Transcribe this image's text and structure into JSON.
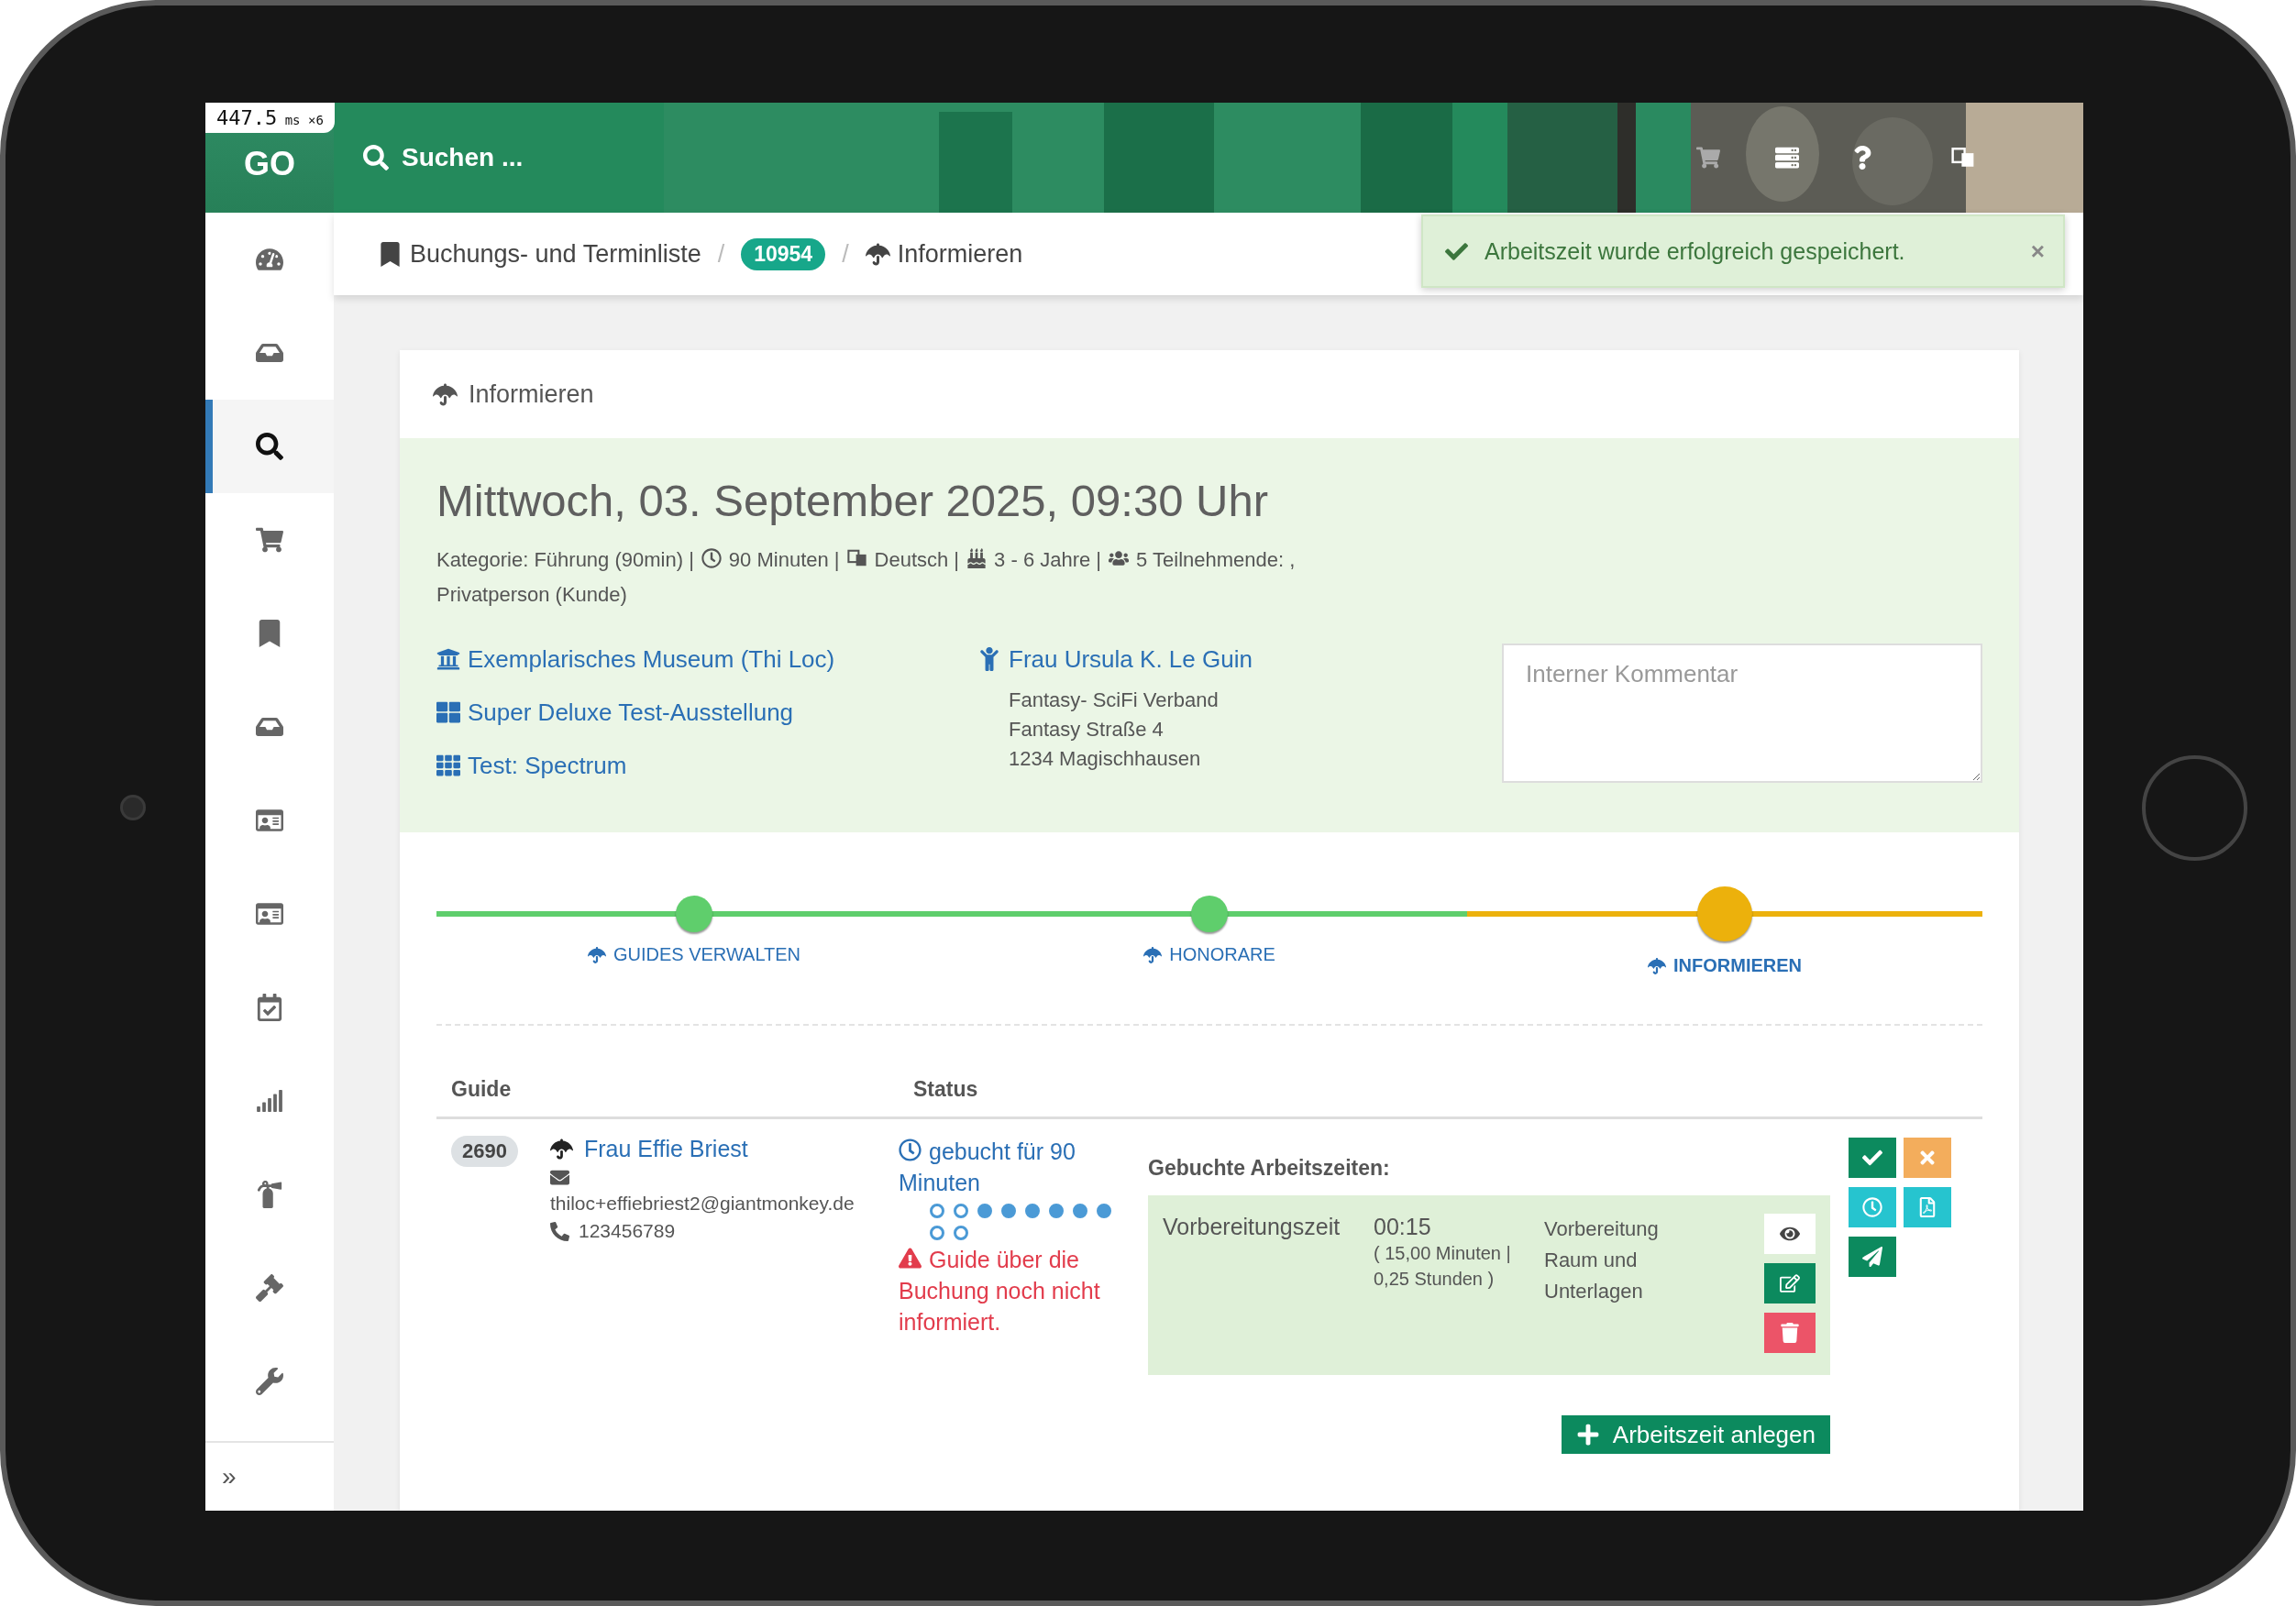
{
  "timing_overlay": {
    "value": "447.5",
    "unit": "ms",
    "count": "×6"
  },
  "topbar": {
    "logo": "GO",
    "search": "Suchen ..."
  },
  "sidebar": {
    "items": [
      {
        "selected": false
      },
      {
        "selected": false
      },
      {
        "selected": true
      },
      {
        "selected": false
      },
      {
        "selected": false
      },
      {
        "selected": false
      },
      {
        "selected": false
      },
      {
        "selected": false
      },
      {
        "selected": false
      },
      {
        "selected": false
      },
      {
        "selected": false
      },
      {
        "selected": false
      },
      {
        "selected": false
      }
    ],
    "expand": "»"
  },
  "breadcrumb": {
    "items": [
      {
        "kind": "link",
        "label": "Buchungs- und Terminliste"
      },
      {
        "kind": "badge",
        "label": "10954"
      },
      {
        "kind": "current",
        "label": "Informieren"
      }
    ],
    "separators": [
      "/",
      "/"
    ]
  },
  "toast": {
    "message": "Arbeitszeit wurde erfolgreich gespeichert.",
    "close": "×"
  },
  "card": {
    "title": "Informieren",
    "date": "Mittwoch, 03. September 2025, 09:30 Uhr",
    "meta": [
      "Kategorie: Führung (90min) |",
      "90 Minuten |",
      "Deutsch |",
      "3 - 6 Jahre |",
      "5 Teilnehmende: ,",
      "Privatperson (Kunde)"
    ],
    "links": [
      "Exemplarisches Museum (Thi Loc)",
      "Super Deluxe Test-Ausstellung",
      "Test: Spectrum"
    ],
    "contact": {
      "name": "Frau Ursula K. Le Guin",
      "lines": [
        "Fantasy- SciFi Verband",
        "Fantasy Straße 4",
        "1234 Magischhausen"
      ]
    },
    "comment": {
      "placeholder": "Interner Kommentar"
    },
    "steps": [
      {
        "label": "GUIDES VERWALTEN",
        "done": true,
        "selected": false
      },
      {
        "label": "HONORARE",
        "done": true,
        "selected": false
      },
      {
        "label": "INFORMIEREN",
        "selected": true
      }
    ],
    "table": {
      "columns": [
        "Guide",
        "Status"
      ],
      "rows": [
        {
          "id": "2690",
          "name": "Frau Effie Briest",
          "email": "thiloc+effiebriest2@giantmonkey.de",
          "phone": "123456789",
          "status": "gebucht für 90 Minuten",
          "dots": [
            {
              "filled": false
            },
            {
              "filled": false
            },
            {
              "filled": true
            },
            {
              "filled": true
            },
            {
              "filled": true
            },
            {
              "filled": true
            },
            {
              "filled": true
            },
            {
              "filled": true
            },
            {
              "filled": false
            },
            {
              "filled": false
            }
          ],
          "warning": "Guide über die Buchung noch nicht informiert.",
          "worktimes_title": "Gebuchte Arbeitszeiten:",
          "worktimes": [
            {
              "type": "Vorbereitungszeit",
              "duration": "00:15",
              "detail": "( 15,00 Minuten | 0,25 Stunden )",
              "note": "Vorbereitung Raum und Unterlagen"
            }
          ],
          "add_button": "Arbeitszeit anlegen"
        }
      ]
    }
  }
}
